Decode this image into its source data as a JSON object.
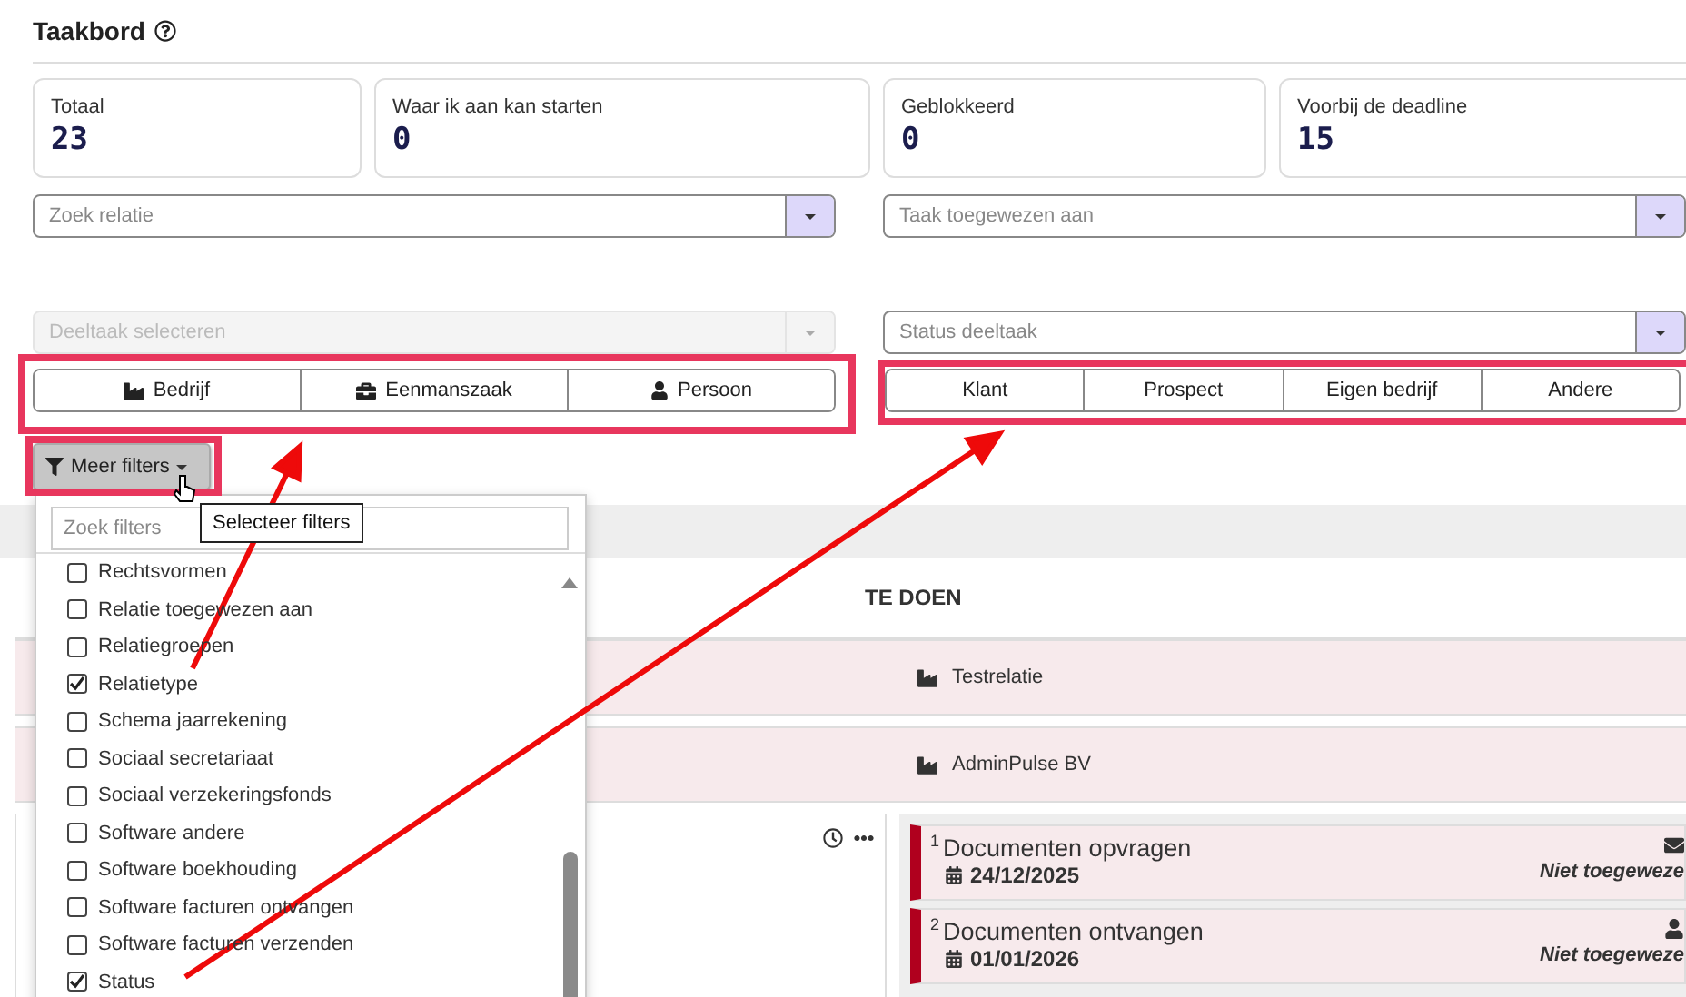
{
  "page": {
    "title": "Taakbord"
  },
  "stats": [
    {
      "label": "Totaal",
      "value": "23"
    },
    {
      "label": "Waar ik aan kan starten",
      "value": "0"
    },
    {
      "label": "Geblokkeerd",
      "value": "0"
    },
    {
      "label": "Voorbij de deadline",
      "value": "15"
    }
  ],
  "selects": [
    {
      "placeholder": "Zoek relatie",
      "disabled": false
    },
    {
      "placeholder": "Taak toegewezen aan",
      "disabled": false
    },
    {
      "placeholder": "Deeltaak selecteren",
      "disabled": true
    },
    {
      "placeholder": "Status deeltaak",
      "disabled": false
    }
  ],
  "relation_forms": [
    {
      "label": "Bedrijf",
      "kind": "company"
    },
    {
      "label": "Eenmanszaak",
      "kind": "sole_trader"
    },
    {
      "label": "Persoon",
      "kind": "person"
    }
  ],
  "relation_types": [
    {
      "label": "Klant"
    },
    {
      "label": "Prospect"
    },
    {
      "label": "Eigen bedrijf"
    },
    {
      "label": "Andere"
    }
  ],
  "more_filters": {
    "label": "Meer filters",
    "search_placeholder": "Zoek filters",
    "tooltip": "Selecteer filters",
    "options": [
      {
        "label": "Rechtsvormen",
        "checked": false
      },
      {
        "label": "Relatie toegewezen aan",
        "checked": false
      },
      {
        "label": "Relatiegroepen",
        "checked": false
      },
      {
        "label": "Relatietype",
        "checked": true
      },
      {
        "label": "Schema jaarrekening",
        "checked": false
      },
      {
        "label": "Sociaal secretariaat",
        "checked": false
      },
      {
        "label": "Sociaal verzekeringsfonds",
        "checked": false
      },
      {
        "label": "Software andere",
        "checked": false
      },
      {
        "label": "Software boekhouding",
        "checked": false
      },
      {
        "label": "Software facturen ontvangen",
        "checked": false
      },
      {
        "label": "Software facturen verzenden",
        "checked": false
      },
      {
        "label": "Status",
        "checked": true
      }
    ]
  },
  "board": {
    "column_title": "TE DOEN",
    "relations": [
      {
        "name": "Testrelatie"
      },
      {
        "name": "AdminPulse BV"
      }
    ],
    "tasks": [
      {
        "number": "1",
        "title": "Documenten opvragen",
        "date": "24/12/2025",
        "kind": "email",
        "assignee": "Niet toegeweze"
      },
      {
        "number": "2",
        "title": "Documenten ontvangen",
        "date": "01/01/2026",
        "kind": "person",
        "assignee": "Niet toegeweze"
      }
    ]
  }
}
